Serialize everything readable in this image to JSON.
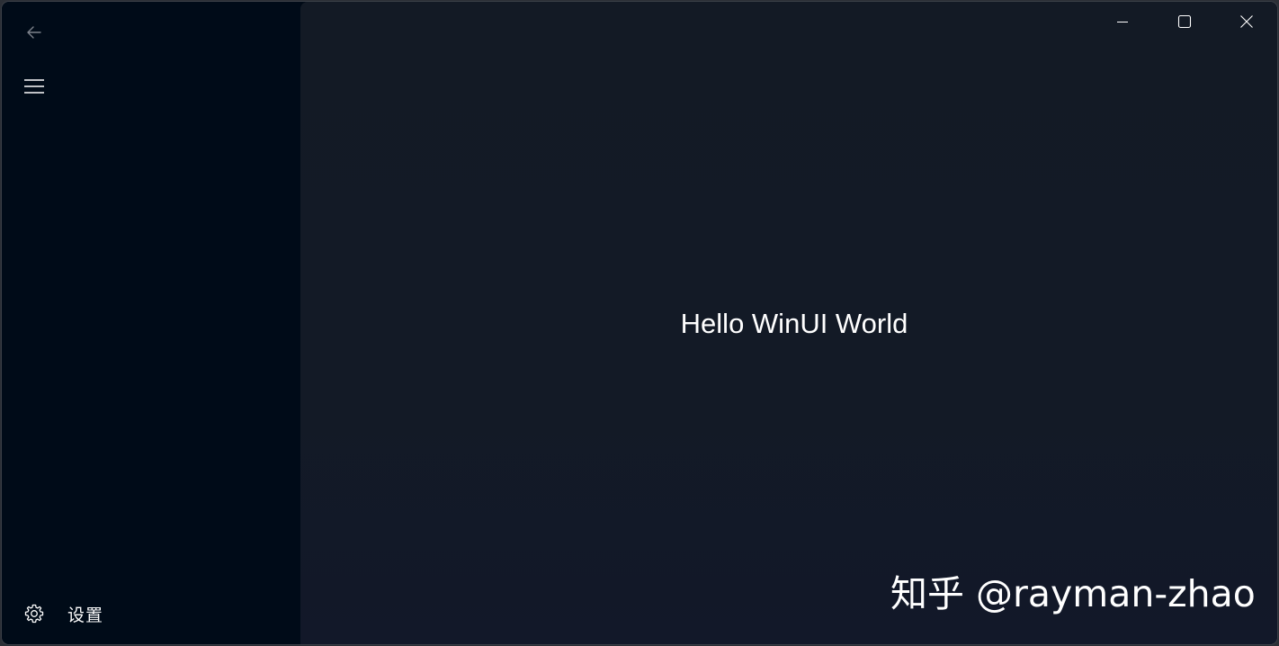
{
  "window": {
    "content_text": "Hello WinUI World"
  },
  "nav": {
    "settings_label": "设置"
  },
  "watermark": {
    "text": "知乎 @rayman-zhao"
  },
  "icons": {
    "back": "back-arrow-icon",
    "menu": "hamburger-menu-icon",
    "settings": "gear-icon",
    "minimize": "minimize-icon",
    "maximize": "maximize-icon",
    "close": "close-icon"
  },
  "colors": {
    "nav_background": "#000b18",
    "content_background": "#131a25",
    "text": "#ffffff",
    "muted_icon": "#8a9099"
  }
}
